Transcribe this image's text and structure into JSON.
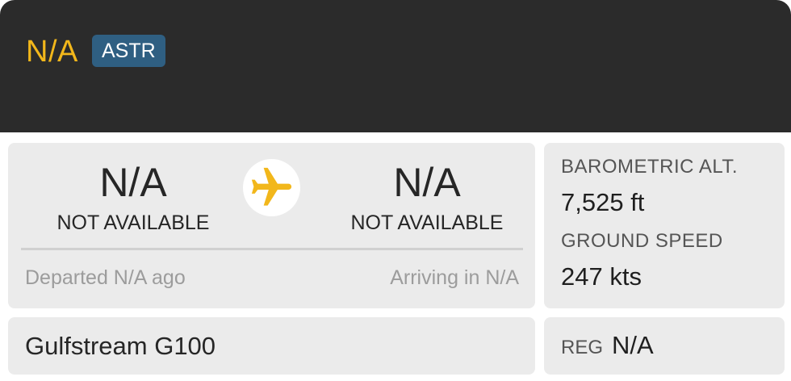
{
  "header": {
    "callsign": "N/A",
    "airline_code": "ASTR",
    "background": "#2b2b2b",
    "callsign_color": "#f2b71b",
    "badge_color": "#2f5f82"
  },
  "route": {
    "origin": {
      "code": "N/A",
      "name": "NOT AVAILABLE"
    },
    "destination": {
      "code": "N/A",
      "name": "NOT AVAILABLE"
    },
    "plane_icon": "airplane-icon",
    "plane_color": "#f2b71b",
    "departed_text": "Departed N/A ago",
    "arriving_text": "Arriving in N/A"
  },
  "stats": {
    "altitude_label": "BAROMETRIC ALT.",
    "altitude_value": "7,525 ft",
    "speed_label": "GROUND SPEED",
    "speed_value": "247 kts"
  },
  "aircraft": {
    "type": "Gulfstream G100"
  },
  "registration": {
    "label": "REG",
    "value": "N/A"
  }
}
